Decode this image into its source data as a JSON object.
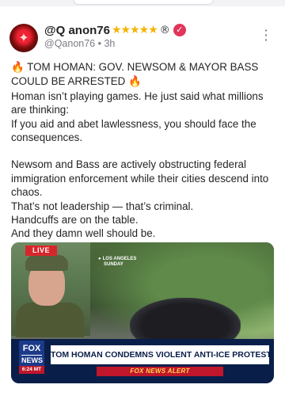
{
  "post": {
    "display_name": "@Q anon76",
    "stars": "★★★★★",
    "registered": "®",
    "verified_icon": "verified-badge-icon",
    "handle": "@Qanon76",
    "separator": "•",
    "time": "3h",
    "more_icon": "more-vertical-icon",
    "fire": "🔥",
    "headline_text": "TOM HOMAN: GOV. NEWSOM & MAYOR BASS COULD BE ARRESTED",
    "lines": [
      "Homan isn’t playing games. He just said what millions are thinking:",
      "If you aid and abet lawlessness, you should face the consequences.",
      "Newsom and Bass are actively obstructing federal immigration enforcement while their cities descend into chaos.",
      "That’s not leadership — that’s criminal.",
      "Handcuffs are on the table.",
      "And they damn well should be."
    ]
  },
  "media": {
    "live_label": "LIVE",
    "location_line1": "LOS ANGELES",
    "location_line2": "SUNDAY",
    "logo_top": "FOX",
    "logo_bottom": "NEWS",
    "time": "6:24 MT",
    "headline": "TOM HOMAN CONDEMNS VIOLENT ANTI-ICE PROTESTERS",
    "alert": "FOX NEWS ALERT"
  },
  "colors": {
    "verified": "#e2355a",
    "stars": "#f5b301",
    "live": "#d7262b",
    "lower_third": "#0a1e4a",
    "alert": "#c0162b"
  }
}
